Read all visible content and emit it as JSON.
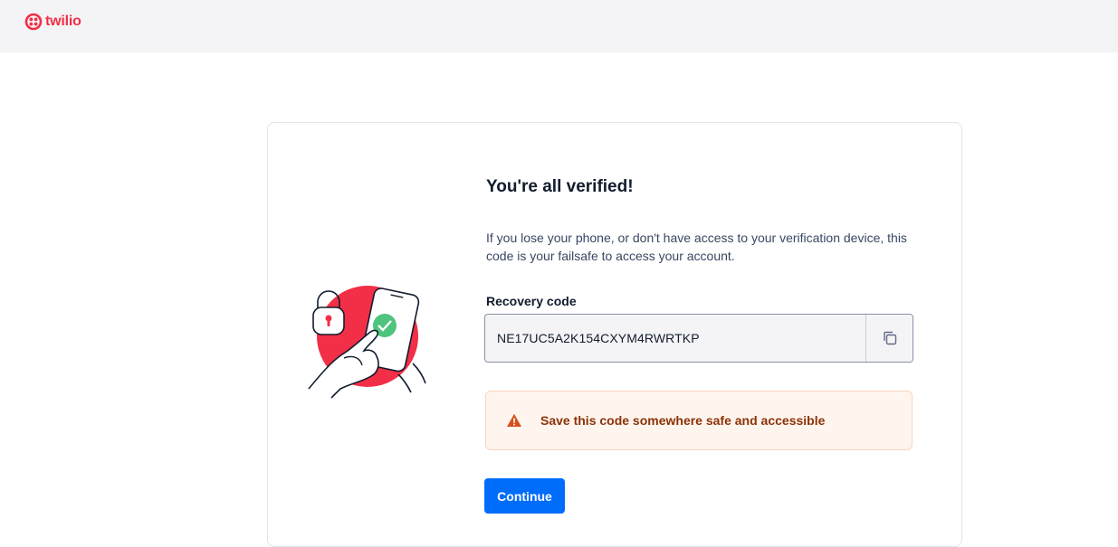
{
  "header": {
    "brand_name": "twilio",
    "logo_icon": "twilio-logo-icon",
    "background": "#f4f4f6",
    "brand_color": "#f22f46"
  },
  "main": {
    "illustration_icon": "phone-verified-illustration",
    "title": "You're all verified!",
    "description": "If you lose your phone, or don't have access to your verification device, this code is your failsafe to access your account.",
    "recovery": {
      "label": "Recovery code",
      "value": "NE17UC5A2K154CXYM4RWRTKP",
      "copy_icon": "copy-icon"
    },
    "warning": {
      "icon": "warning-icon",
      "text": "Save this code somewhere safe and accessible",
      "background": "#fef5ee",
      "text_color": "#8c3208"
    },
    "continue_label": "Continue",
    "accent": "#006dfa"
  }
}
